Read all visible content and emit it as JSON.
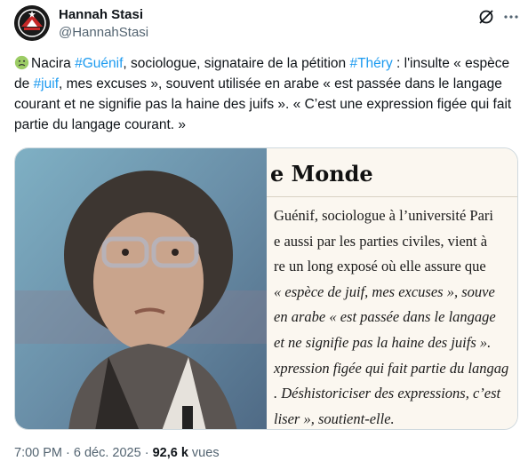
{
  "author": {
    "name": "Hannah Stasi",
    "handle": "@HannahStasi"
  },
  "tweet": {
    "emoji": "nauseated-face-emoji",
    "segments": [
      {
        "text": "Nacira ",
        "tag": false
      },
      {
        "text": "#Guénif",
        "tag": true
      },
      {
        "text": ", sociologue, signataire de la pétition ",
        "tag": false
      },
      {
        "text": "#Théry",
        "tag": true
      },
      {
        "text": " : l'insulte « espèce de ",
        "tag": false
      },
      {
        "text": "#juif",
        "tag": true
      },
      {
        "text": ", mes excuses », souvent utilisée en arabe « est passée dans le langage courant et ne signifie pas la haine des juifs ». « C’est une expression figée qui fait partie du langage courant. »",
        "tag": false
      }
    ]
  },
  "article": {
    "masthead": "e Monde",
    "lines": [
      {
        "text": "Guénif, sociologue à l’université Pari",
        "italic": false
      },
      {
        "text": "e aussi par les parties civiles, vient à",
        "italic": false
      },
      {
        "text": "re un long exposé où elle assure que",
        "italic": false
      },
      {
        "text": "« espèce de juif, mes excuses », souve",
        "italic": true
      },
      {
        "text": "en arabe « est passée dans le langage",
        "italic": true
      },
      {
        "text": "et ne signifie pas la haine des juifs ».",
        "italic": true
      },
      {
        "text": "xpression figée qui fait partie du langag",
        "italic": true
      },
      {
        "text": ". Déshistoriciser des expressions, c’est",
        "italic": true
      },
      {
        "text": "liser », soutient-elle.",
        "italic": true
      }
    ]
  },
  "meta": {
    "time": "7:00 PM",
    "sep": " · ",
    "date": "6 déc. 2025",
    "views": "92,6 k",
    "views_label": " vues"
  },
  "colors": {
    "link": "#1d9bf0",
    "secondary": "#536471"
  }
}
